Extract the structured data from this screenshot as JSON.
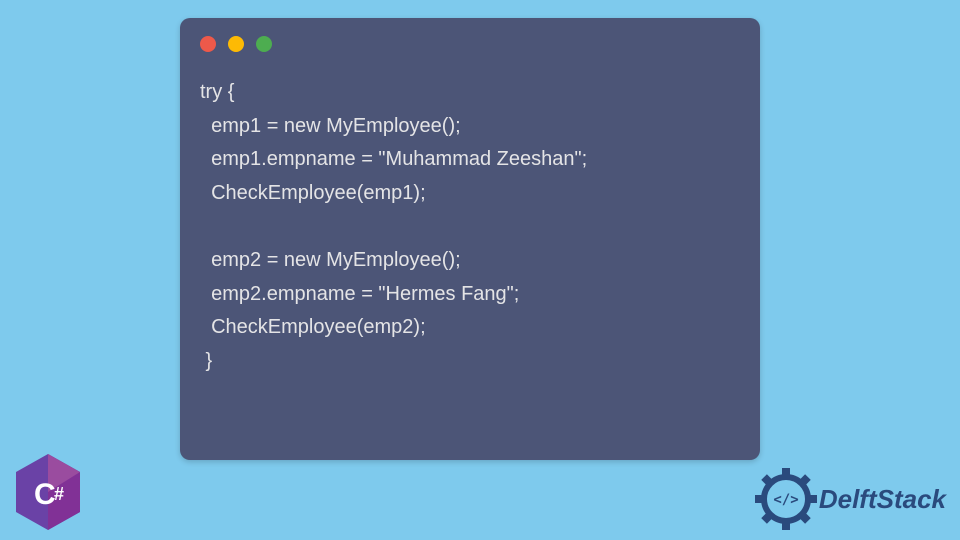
{
  "code": {
    "lines": [
      "try {",
      "  emp1 = new MyEmployee();",
      "  emp1.empname = \"Muhammad Zeeshan\";",
      "  CheckEmployee(emp1);",
      "",
      "  emp2 = new MyEmployee();",
      "  emp2.empname = \"Hermes Fang\";",
      "  CheckEmployee(emp2);",
      " }"
    ]
  },
  "badges": {
    "csharp_label": "C#",
    "brand_name": "DelftStack"
  },
  "colors": {
    "background": "#7ecaed",
    "window_bg": "#4c5577",
    "code_text": "#e4e4e6",
    "dot_red": "#ed594a",
    "dot_yellow": "#fdba04",
    "dot_green": "#4dad50",
    "csharp_purple": "#6a42a6",
    "delft_blue": "#2a4a7d"
  }
}
